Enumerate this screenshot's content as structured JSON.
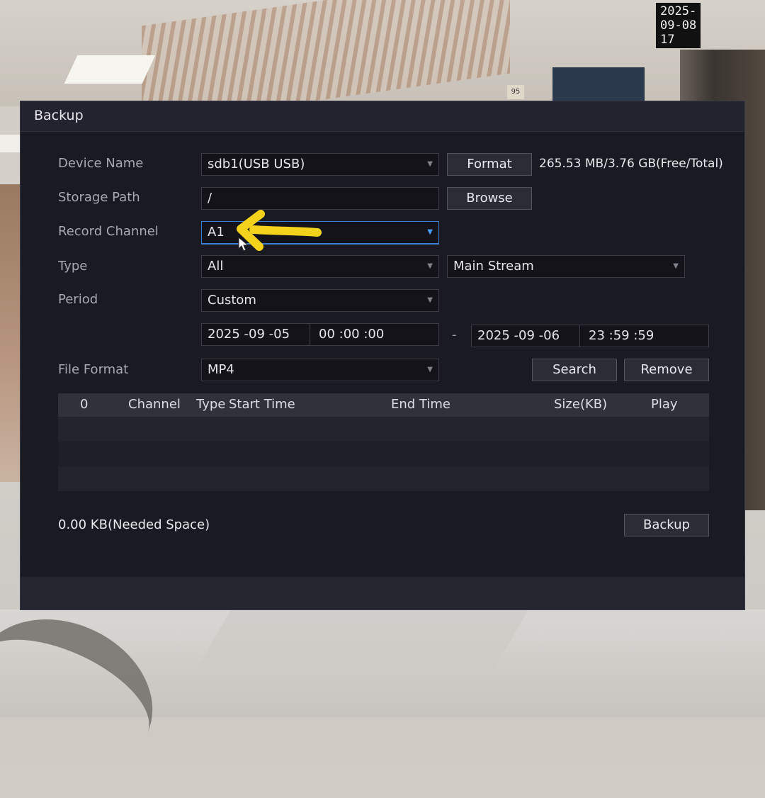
{
  "osd": {
    "datetime": "2025-09-08 17"
  },
  "background": {
    "sign_number": "95"
  },
  "dialog": {
    "title": "Backup",
    "device_name": {
      "label": "Device Name",
      "value": "sdb1(USB USB)"
    },
    "format_button": "Format",
    "storage_info": "265.53 MB/3.76 GB(Free/Total)",
    "storage_path": {
      "label": "Storage Path",
      "value": "/"
    },
    "browse_button": "Browse",
    "record_channel": {
      "label": "Record Channel",
      "value": "A1"
    },
    "type": {
      "label": "Type",
      "value": "All",
      "stream": "Main Stream"
    },
    "period": {
      "label": "Period",
      "value": "Custom"
    },
    "start": {
      "date": "2025 -09 -05",
      "time": "00 :00 :00"
    },
    "range_separator": "-",
    "end": {
      "date": "2025 -09 -06",
      "time": "23 :59 :59"
    },
    "file_format": {
      "label": "File Format",
      "value": "MP4"
    },
    "search_button": "Search",
    "remove_button": "Remove",
    "table": {
      "columns": [
        "0",
        "Channel",
        "Type",
        "Start Time",
        "End Time",
        "Size(KB)",
        "Play"
      ],
      "rows": []
    },
    "needed_space": "0.00 KB(Needed Space)",
    "backup_button": "Backup"
  },
  "colors": {
    "accent": "#3b7fd6",
    "annotation_arrow": "#f2d21b",
    "alarm": "#e03030"
  }
}
